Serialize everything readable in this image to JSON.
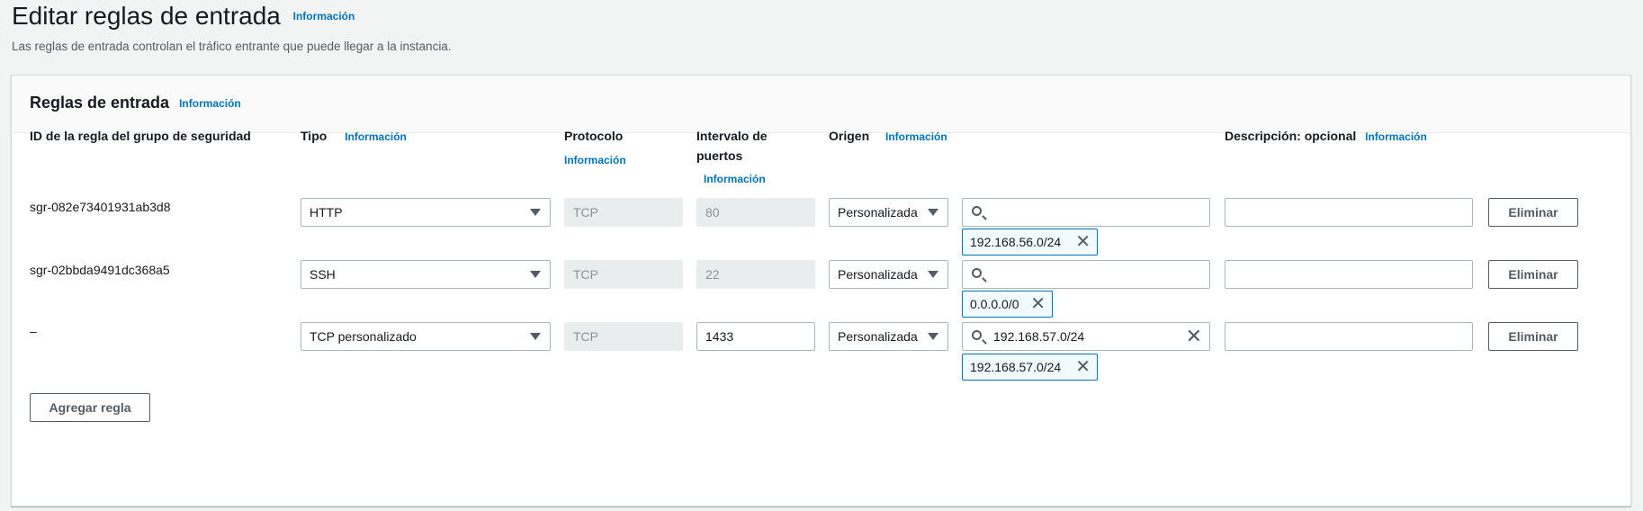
{
  "page": {
    "title": "Editar reglas de entrada",
    "info_label": "Información",
    "description": "Las reglas de entrada controlan el tráfico entrante que puede llegar a la instancia."
  },
  "panel": {
    "title": "Reglas de entrada",
    "info_label": "Información",
    "columns": {
      "id": "ID de la regla del grupo de seguridad",
      "type": "Tipo",
      "protocol": "Protocolo",
      "port_line1": "Intervalo de",
      "port_line2": "puertos",
      "origin": "Origen",
      "description": "Descripción: opcional"
    },
    "rules": [
      {
        "id": "sgr-082e73401931ab3d8",
        "type": "HTTP",
        "protocol": "TCP",
        "port": "80",
        "origin": "Personalizada",
        "search_value": "",
        "token": "192.168.56.0/24",
        "description": "",
        "delete_label": "Eliminar"
      },
      {
        "id": "sgr-02bbda9491dc368a5",
        "type": "SSH",
        "protocol": "TCP",
        "port": "22",
        "origin": "Personalizada",
        "search_value": "",
        "token": "0.0.0.0/0",
        "description": "",
        "delete_label": "Eliminar"
      },
      {
        "id": "–",
        "type": "TCP personalizado",
        "protocol": "TCP",
        "port": "1433",
        "origin": "Personalizada",
        "search_value": "192.168.57.0/24",
        "token": "192.168.57.0/24",
        "description": "",
        "delete_label": "Eliminar"
      }
    ],
    "add_rule_label": "Agregar regla"
  },
  "colors": {
    "background": "#f2f3f3",
    "link": "#0073bb",
    "token_border": "#0073bb",
    "token_bg": "#f1faff",
    "disabled_bg": "#eaeded"
  }
}
